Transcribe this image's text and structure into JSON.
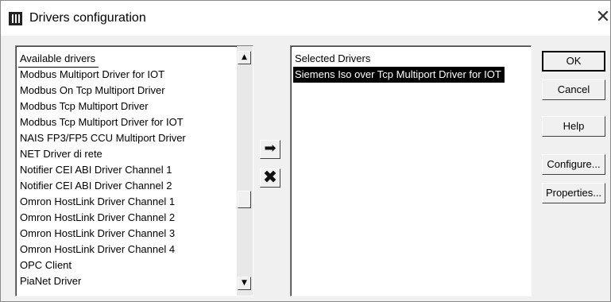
{
  "window": {
    "title": "Drivers configuration",
    "close_glyph": "✕"
  },
  "available": {
    "header": "Available drivers",
    "items": [
      "Modbus Multiport Driver for IOT",
      "Modbus On Tcp Multiport Driver",
      "Modbus Tcp Multiport Driver",
      "Modbus Tcp Multiport Driver for IOT",
      "NAIS FP3/FP5 CCU Multiport Driver",
      "NET Driver di rete",
      "Notifier CEI ABI Driver Channel 1",
      "Notifier CEI ABI Driver Channel 2",
      "Omron HostLink Driver Channel 1",
      "Omron HostLink Driver Channel 2",
      "Omron HostLink Driver Channel 3",
      "Omron HostLink Driver Channel 4",
      "OPC Client",
      "PiaNet Driver"
    ]
  },
  "selected": {
    "header": "Selected Drivers",
    "items": [
      "Siemens Iso over Tcp Multiport Driver for IOT"
    ]
  },
  "arrows": {
    "add_icon": "arrow-right-icon",
    "remove_icon": "x-icon",
    "add_glyph": "➡",
    "remove_glyph": "✖"
  },
  "scroll": {
    "up_glyph": "▲",
    "down_glyph": "▼"
  },
  "buttons": {
    "ok": "OK",
    "cancel": "Cancel",
    "help": "Help",
    "configure": "Configure...",
    "properties": "Properties..."
  }
}
